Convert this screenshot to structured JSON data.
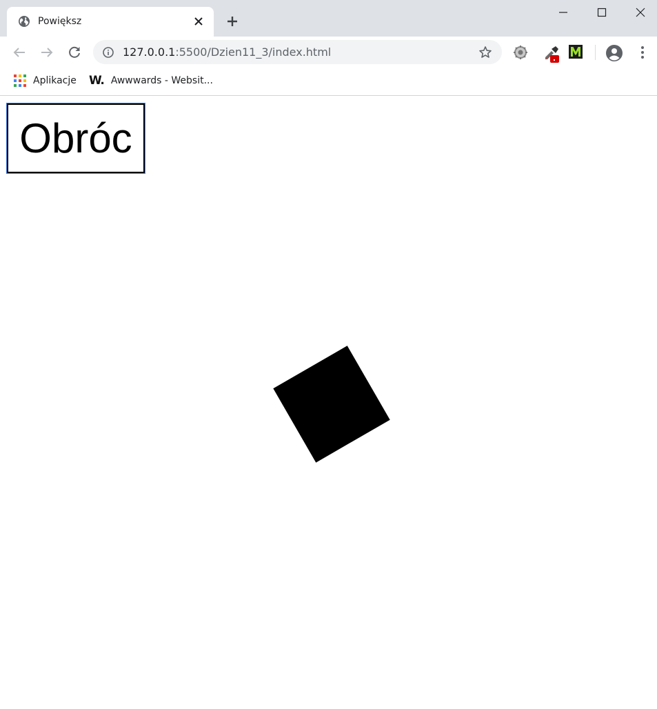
{
  "browser": {
    "tab": {
      "title": "Powiększ",
      "favicon": "globe-icon"
    },
    "address_bar": {
      "host": "127.0.0.1",
      "path": ":5500/Dzien11_3/index.html"
    },
    "bookmarks": [
      {
        "label": "Aplikacje",
        "icon": "apps-grid-icon"
      },
      {
        "label": "Awwwards - Websit...",
        "icon": "awwwards-logo-icon",
        "logo_text": "W."
      }
    ],
    "extensions": [
      {
        "name": "gear-extension-icon"
      },
      {
        "name": "color-picker-extension-icon"
      },
      {
        "name": "m-extension-icon",
        "letter": "M"
      }
    ]
  },
  "page": {
    "button_label": "Obróc",
    "square_rotation_deg": -30,
    "square_color": "#000000"
  },
  "colors": {
    "tabstrip": "#dee1e6",
    "focus_outline": "#3d7ee6",
    "omnibox": "#f1f3f4"
  }
}
